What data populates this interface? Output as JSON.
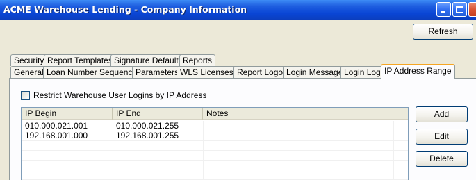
{
  "window": {
    "title": "ACME Warehouse Lending - Company Information"
  },
  "toolbar": {
    "refresh_label": "Refresh"
  },
  "tabs": {
    "row1": [
      {
        "label": "Security"
      },
      {
        "label": "Report Templates"
      },
      {
        "label": "Signature Defaults"
      },
      {
        "label": "Reports"
      }
    ],
    "row2": [
      {
        "label": "General"
      },
      {
        "label": "Loan Number Sequence"
      },
      {
        "label": "Parameters"
      },
      {
        "label": "WLS Licenses"
      },
      {
        "label": "Report Logo"
      },
      {
        "label": "Login Message"
      },
      {
        "label": "Login Log"
      },
      {
        "label": "IP Address Range"
      }
    ],
    "active": "IP Address Range"
  },
  "restrict": {
    "label": "Restrict Warehouse User Logins by IP Address",
    "checked": false
  },
  "grid": {
    "columns": [
      "IP Begin",
      "IP End",
      "Notes",
      ""
    ],
    "rows": [
      {
        "begin": "010.000.021.001",
        "end": "010.000.021.255",
        "notes": ""
      },
      {
        "begin": "192.168.001.000",
        "end": "192.168.001.255",
        "notes": ""
      }
    ]
  },
  "actions": {
    "add_label": "Add",
    "edit_label": "Edit",
    "delete_label": "Delete"
  }
}
